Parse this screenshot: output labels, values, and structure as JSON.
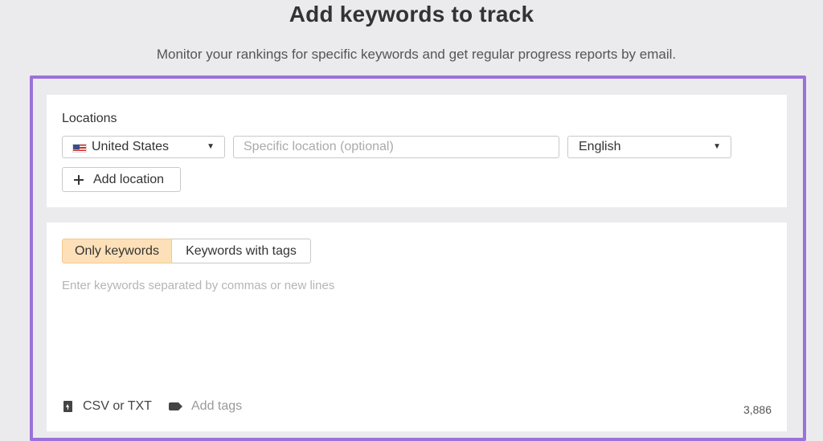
{
  "header": {
    "title": "Add keywords to track",
    "subtitle": "Monitor your rankings for specific keywords and get regular progress reports by email."
  },
  "locations": {
    "label": "Locations",
    "country": {
      "value": "United States",
      "flag_icon": "us-flag-icon"
    },
    "specific_location": {
      "value": "",
      "placeholder": "Specific location (optional)"
    },
    "language": {
      "value": "English"
    },
    "add_location_label": "Add location"
  },
  "keywords": {
    "tabs": [
      {
        "label": "Only keywords",
        "active": true
      },
      {
        "label": "Keywords with tags",
        "active": false
      }
    ],
    "textarea": {
      "value": "",
      "placeholder": "Enter keywords separated by commas or new lines"
    },
    "upload_label": "CSV or TXT",
    "add_tags_label": "Add tags",
    "remaining_count": "3,886"
  },
  "colors": {
    "highlight_frame": "#9b72d9",
    "active_tab_bg": "#fde0b8",
    "page_bg": "#ebebed"
  }
}
